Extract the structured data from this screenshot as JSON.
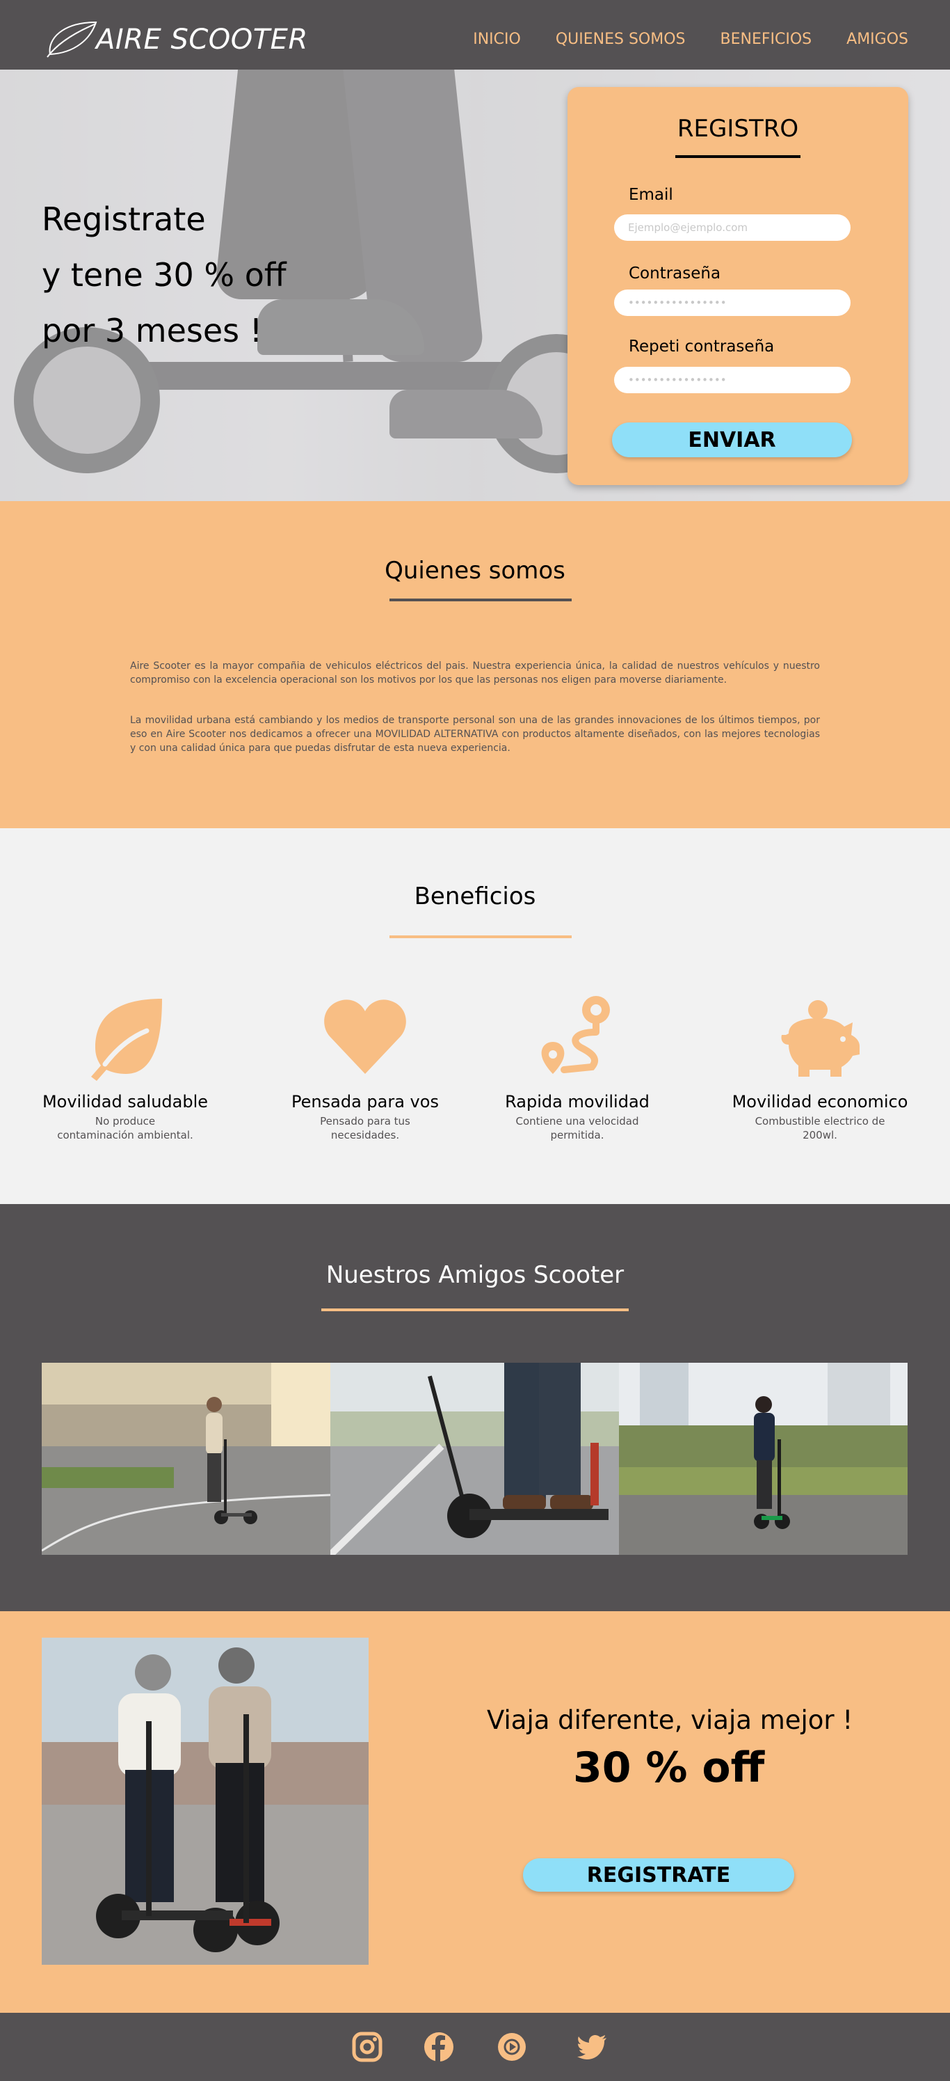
{
  "brand": {
    "name": "AIRE SCOOTER",
    "accent": "#f8be84",
    "dark": "#545153",
    "button": "#8fdff8"
  },
  "nav": {
    "items": [
      {
        "label": "INICIO"
      },
      {
        "label": "QUIENES SOMOS"
      },
      {
        "label": "BENEFICIOS"
      },
      {
        "label": "AMIGOS"
      }
    ]
  },
  "hero": {
    "line1": "Registrate",
    "line2": "y tene 30 % off",
    "line3": "por 3 meses !"
  },
  "register": {
    "title": "REGISTRO",
    "email_label": "Email",
    "email_placeholder": "Ejemplo@ejemplo.com",
    "password_label": "Contraseña",
    "password_placeholder": "••••••••••••••••",
    "repeat_label": "Repeti contraseña",
    "repeat_placeholder": "••••••••••••••••",
    "submit": "ENVIAR"
  },
  "quienes": {
    "title": "Quienes somos",
    "p1": "Aire Scooter  es la mayor compañia de vehiculos eléctricos del pais. Nuestra experiencia única, la calidad de nuestros vehículos y nuestro compromiso con la excelencia operacional son los motivos por los que las personas nos eligen para moverse diariamente.",
    "p2": "La movilidad urbana está cambiando y los medios de transporte personal son una de las grandes innovaciones de los últimos tiempos, por eso en Aire Scooter nos dedicamos a ofrecer una MOVILIDAD ALTERNATIVA con productos altamente diseñados, con las mejores tecnologias y con una calidad única para que puedas disfrutar de esta nueva experiencia."
  },
  "beneficios": {
    "title": "Beneficios",
    "items": [
      {
        "icon": "leaf-icon",
        "title": "Movilidad saludable",
        "desc": "No produce contaminación ambiental."
      },
      {
        "icon": "heart-icon",
        "title": "Pensada para vos",
        "desc": "Pensado para tus necesidades."
      },
      {
        "icon": "route-icon",
        "title": "Rapida movilidad",
        "desc": "Contiene una velocidad permitida."
      },
      {
        "icon": "piggy-bank-icon",
        "title": "Movilidad economico",
        "desc": "Combustible electrico de 200wl."
      }
    ]
  },
  "amigos": {
    "title": "Nuestros Amigos Scooter"
  },
  "promo": {
    "subtitle": "Viaja diferente, viaja mejor !",
    "discount": "30 % off",
    "cta": "REGISTRATE"
  },
  "footer": {
    "icons": [
      "instagram-icon",
      "facebook-icon",
      "youtube-icon",
      "twitter-icon"
    ]
  }
}
